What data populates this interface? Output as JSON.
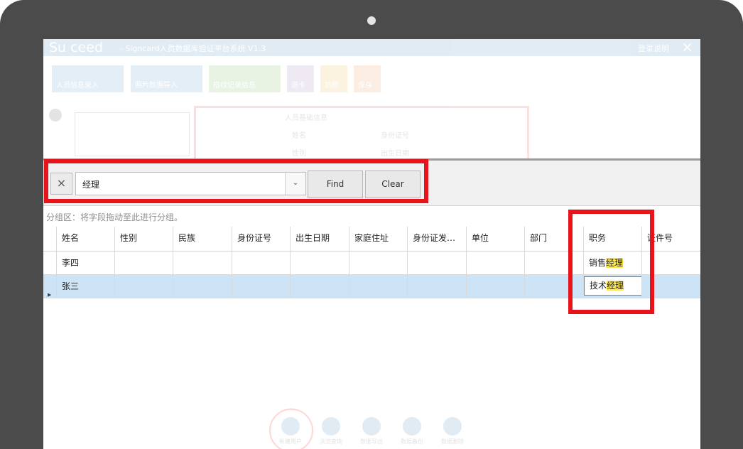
{
  "app": {
    "logo": "Su ceed",
    "title": "- Signcard人员数据库验证平台系统 V1.3",
    "topRight": "登录说明",
    "toolbar": [
      "人员信息录入",
      "照片数据导入",
      "指纹记录信息",
      "退卡",
      "拍照",
      "保存"
    ],
    "form": {
      "group": "人员基础信息",
      "name": "姓名",
      "id": "身份证号",
      "gender": "性别",
      "birth": "出生日期"
    }
  },
  "search": {
    "clear_x": "×",
    "value": "经理",
    "dropdown": "⌄",
    "find": "Find",
    "clear": "Clear"
  },
  "group_hint": "分组区：将字段拖动至此进行分组。",
  "grid": {
    "columns": [
      "姓名",
      "性别",
      "民族",
      "身份证号",
      "出生日期",
      "家庭住址",
      "身份证发…",
      "单位",
      "部门",
      "职务",
      "证件号"
    ],
    "rows": [
      {
        "name": "李四",
        "job_prefix": "销售",
        "job_match": "经理"
      },
      {
        "name": "张三",
        "job_prefix": "技术",
        "job_match": "经理"
      }
    ]
  },
  "bottom": [
    "新建用户",
    "浏览查询",
    "数据导出",
    "数据备份",
    "数据删除"
  ],
  "colors": {
    "highlight": "#ffe84a",
    "selected_row": "#cde4f7",
    "annotation_red": "#e8141b"
  }
}
